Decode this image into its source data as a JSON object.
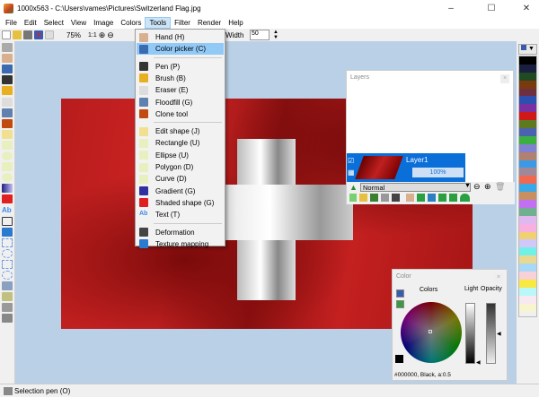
{
  "window": {
    "title": "1000x563 - C:\\Users\\vames\\Pictures\\Switzerland Flag.jpg",
    "minimize": "–",
    "maximize": "☐",
    "close": "✕"
  },
  "menubar": [
    "File",
    "Edit",
    "Select",
    "View",
    "Image",
    "Colors",
    "Tools",
    "Filter",
    "Render",
    "Help"
  ],
  "toolbar": {
    "zoom": "75%",
    "one_to_one": "1:1",
    "width_label": "Width",
    "width_value": "50"
  },
  "tools_menu": {
    "items": [
      {
        "label": "Hand (H)",
        "icon": "hand-icon",
        "color": "#d8b090"
      },
      {
        "label": "Color picker (C)",
        "icon": "color-picker-icon",
        "color": "#3a6ab0",
        "highlighted": true
      },
      {
        "label": "Pen (P)",
        "icon": "pen-icon",
        "color": "#333333"
      },
      {
        "label": "Brush (B)",
        "icon": "brush-icon",
        "color": "#e8b020"
      },
      {
        "label": "Eraser (E)",
        "icon": "eraser-icon",
        "color": "#dddddd"
      },
      {
        "label": "Floodfill (G)",
        "icon": "floodfill-icon",
        "color": "#6080b0"
      },
      {
        "label": "Clone tool",
        "icon": "clone-stamp-icon",
        "color": "#c04a10"
      },
      {
        "label": "Edit shape (J)",
        "icon": "edit-shape-icon",
        "color": "#f0e090"
      },
      {
        "label": "Rectangle (U)",
        "icon": "rectangle-icon",
        "color": "#e8f0c0"
      },
      {
        "label": "Ellipse (U)",
        "icon": "ellipse-icon",
        "color": "#e8f0c0"
      },
      {
        "label": "Polygon (D)",
        "icon": "polygon-icon",
        "color": "#e8f0c0"
      },
      {
        "label": "Curve (D)",
        "icon": "curve-icon",
        "color": "#e8f0c0"
      },
      {
        "label": "Gradient (G)",
        "icon": "gradient-icon",
        "color": "#3030a0"
      },
      {
        "label": "Shaded shape (G)",
        "icon": "shaded-shape-icon",
        "color": "#e02020"
      },
      {
        "label": "Text (T)",
        "icon": "text-icon",
        "color": "#3a8ae8",
        "glyph": "Ab"
      },
      {
        "label": "Deformation",
        "icon": "deformation-icon",
        "color": "#444444"
      },
      {
        "label": "Texture mapping",
        "icon": "texture-mapping-icon",
        "color": "#2a7ad0"
      }
    ]
  },
  "layers": {
    "title": "Layers",
    "close": "×",
    "layer_name": "Layer1",
    "opacity": "100%",
    "blend_mode": "Normal"
  },
  "color_panel": {
    "title": "Color",
    "close": "×",
    "colors_label": "Colors",
    "light_label": "Light",
    "opacity_label": "Opacity",
    "status": "#000000, Black, a:0.5"
  },
  "palette": [
    "#000000",
    "#1a1f3f",
    "#1f4a22",
    "#7a3a10",
    "#6e3040",
    "#2d4fb0",
    "#7a30a0",
    "#d01818",
    "#5e7a20",
    "#4a62b0",
    "#3ab040",
    "#8080d0",
    "#b08070",
    "#3a9ae8",
    "#a08898",
    "#f06850",
    "#38a8e8",
    "#c89060",
    "#c070f0",
    "#70b090",
    "#e0b8f0",
    "#f8b0e0",
    "#f0d070",
    "#d0c8f8",
    "#70f0e8",
    "#e8d890",
    "#a8d8f8",
    "#f8d0d8",
    "#f8e840",
    "#b8f8f8",
    "#f8e8f0",
    "#f8f4d0"
  ],
  "status": "Selection pen (O)"
}
